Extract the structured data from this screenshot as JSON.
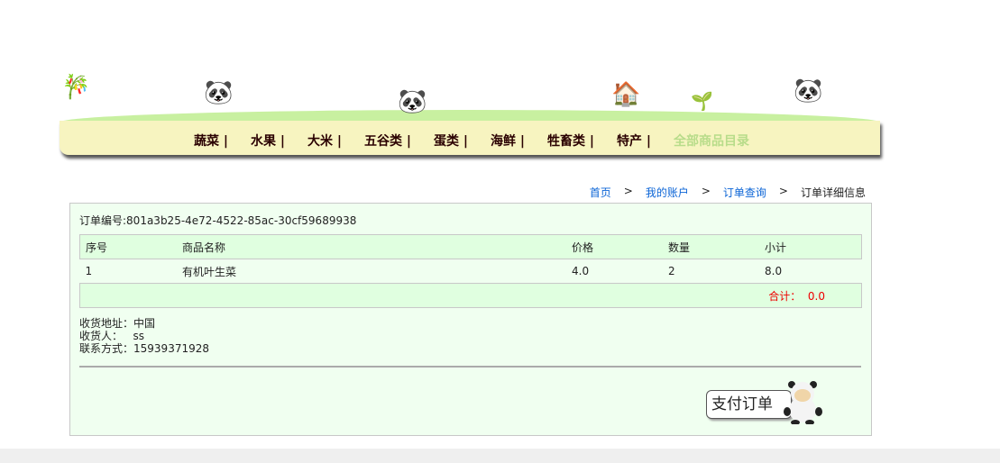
{
  "nav": {
    "items": [
      "蔬菜 |",
      "水果 |",
      "大米 |",
      "五谷类 |",
      "蛋类 |",
      "海鲜 |",
      "牲畜类 |",
      "特产 |"
    ],
    "all_label": "全部商品目录"
  },
  "breadcrumb": {
    "home": "首页",
    "account": "我的账户",
    "orders": "订单查询",
    "current": "订单详细信息",
    "sep": ">"
  },
  "order": {
    "number_label": "订单编号:",
    "number": "801a3b25-4e72-4522-85ac-30cf59689938",
    "columns": [
      "序号",
      "商品名称",
      "价格",
      "数量",
      "小计"
    ],
    "rows": [
      [
        "1",
        "有机叶生菜",
        "4.0",
        "2",
        "8.0"
      ]
    ],
    "total_label": "合计：",
    "total": "0.0",
    "address_label": "收货地址：",
    "address": "中国",
    "receiver_label": "收货人：",
    "receiver": "ss",
    "phone_label": "联系方式：",
    "phone": "15939371928",
    "pay_button": "支付订单"
  }
}
